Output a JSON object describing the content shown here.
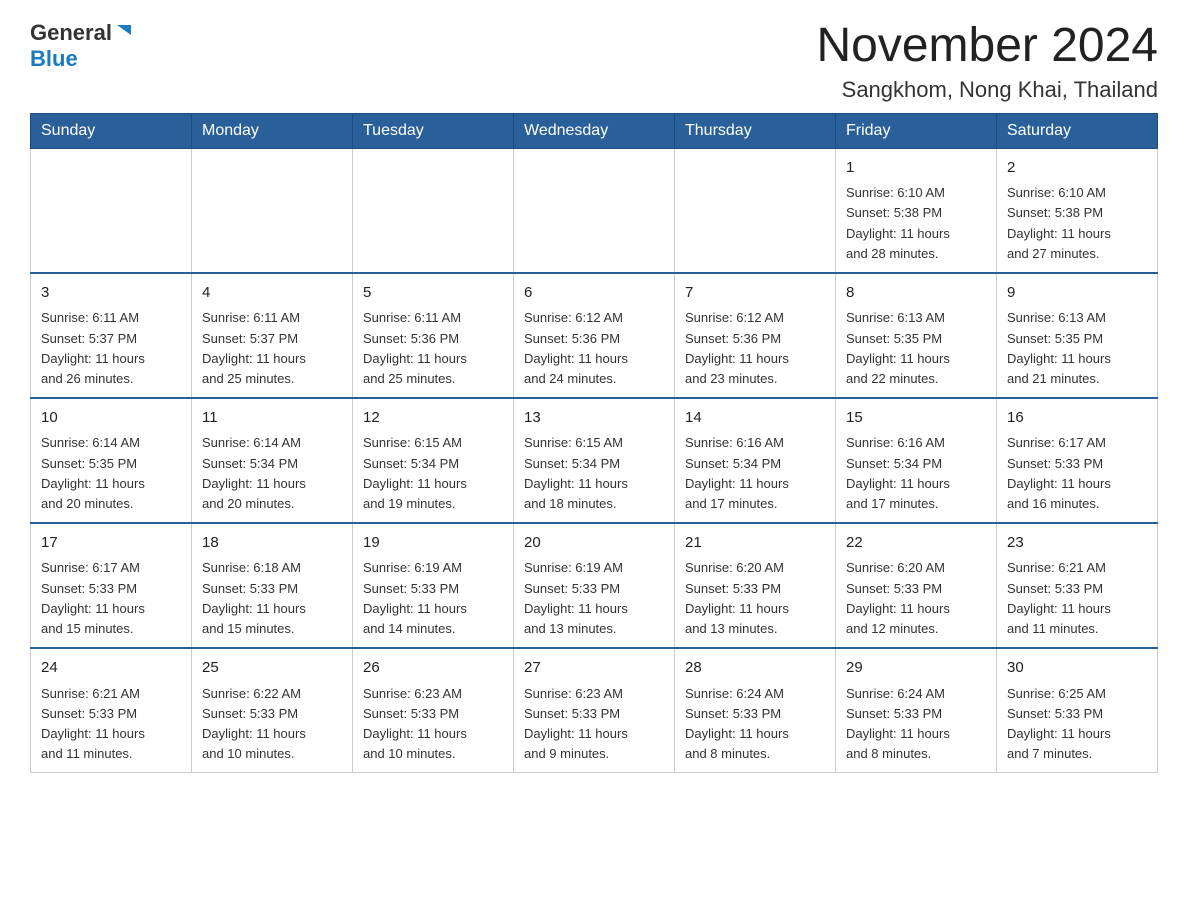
{
  "logo": {
    "general": "General",
    "triangle": "▶",
    "blue": "Blue"
  },
  "title": "November 2024",
  "subtitle": "Sangkhom, Nong Khai, Thailand",
  "weekdays": [
    "Sunday",
    "Monday",
    "Tuesday",
    "Wednesday",
    "Thursday",
    "Friday",
    "Saturday"
  ],
  "weeks": [
    [
      {
        "day": "",
        "info": ""
      },
      {
        "day": "",
        "info": ""
      },
      {
        "day": "",
        "info": ""
      },
      {
        "day": "",
        "info": ""
      },
      {
        "day": "",
        "info": ""
      },
      {
        "day": "1",
        "info": "Sunrise: 6:10 AM\nSunset: 5:38 PM\nDaylight: 11 hours\nand 28 minutes."
      },
      {
        "day": "2",
        "info": "Sunrise: 6:10 AM\nSunset: 5:38 PM\nDaylight: 11 hours\nand 27 minutes."
      }
    ],
    [
      {
        "day": "3",
        "info": "Sunrise: 6:11 AM\nSunset: 5:37 PM\nDaylight: 11 hours\nand 26 minutes."
      },
      {
        "day": "4",
        "info": "Sunrise: 6:11 AM\nSunset: 5:37 PM\nDaylight: 11 hours\nand 25 minutes."
      },
      {
        "day": "5",
        "info": "Sunrise: 6:11 AM\nSunset: 5:36 PM\nDaylight: 11 hours\nand 25 minutes."
      },
      {
        "day": "6",
        "info": "Sunrise: 6:12 AM\nSunset: 5:36 PM\nDaylight: 11 hours\nand 24 minutes."
      },
      {
        "day": "7",
        "info": "Sunrise: 6:12 AM\nSunset: 5:36 PM\nDaylight: 11 hours\nand 23 minutes."
      },
      {
        "day": "8",
        "info": "Sunrise: 6:13 AM\nSunset: 5:35 PM\nDaylight: 11 hours\nand 22 minutes."
      },
      {
        "day": "9",
        "info": "Sunrise: 6:13 AM\nSunset: 5:35 PM\nDaylight: 11 hours\nand 21 minutes."
      }
    ],
    [
      {
        "day": "10",
        "info": "Sunrise: 6:14 AM\nSunset: 5:35 PM\nDaylight: 11 hours\nand 20 minutes."
      },
      {
        "day": "11",
        "info": "Sunrise: 6:14 AM\nSunset: 5:34 PM\nDaylight: 11 hours\nand 20 minutes."
      },
      {
        "day": "12",
        "info": "Sunrise: 6:15 AM\nSunset: 5:34 PM\nDaylight: 11 hours\nand 19 minutes."
      },
      {
        "day": "13",
        "info": "Sunrise: 6:15 AM\nSunset: 5:34 PM\nDaylight: 11 hours\nand 18 minutes."
      },
      {
        "day": "14",
        "info": "Sunrise: 6:16 AM\nSunset: 5:34 PM\nDaylight: 11 hours\nand 17 minutes."
      },
      {
        "day": "15",
        "info": "Sunrise: 6:16 AM\nSunset: 5:34 PM\nDaylight: 11 hours\nand 17 minutes."
      },
      {
        "day": "16",
        "info": "Sunrise: 6:17 AM\nSunset: 5:33 PM\nDaylight: 11 hours\nand 16 minutes."
      }
    ],
    [
      {
        "day": "17",
        "info": "Sunrise: 6:17 AM\nSunset: 5:33 PM\nDaylight: 11 hours\nand 15 minutes."
      },
      {
        "day": "18",
        "info": "Sunrise: 6:18 AM\nSunset: 5:33 PM\nDaylight: 11 hours\nand 15 minutes."
      },
      {
        "day": "19",
        "info": "Sunrise: 6:19 AM\nSunset: 5:33 PM\nDaylight: 11 hours\nand 14 minutes."
      },
      {
        "day": "20",
        "info": "Sunrise: 6:19 AM\nSunset: 5:33 PM\nDaylight: 11 hours\nand 13 minutes."
      },
      {
        "day": "21",
        "info": "Sunrise: 6:20 AM\nSunset: 5:33 PM\nDaylight: 11 hours\nand 13 minutes."
      },
      {
        "day": "22",
        "info": "Sunrise: 6:20 AM\nSunset: 5:33 PM\nDaylight: 11 hours\nand 12 minutes."
      },
      {
        "day": "23",
        "info": "Sunrise: 6:21 AM\nSunset: 5:33 PM\nDaylight: 11 hours\nand 11 minutes."
      }
    ],
    [
      {
        "day": "24",
        "info": "Sunrise: 6:21 AM\nSunset: 5:33 PM\nDaylight: 11 hours\nand 11 minutes."
      },
      {
        "day": "25",
        "info": "Sunrise: 6:22 AM\nSunset: 5:33 PM\nDaylight: 11 hours\nand 10 minutes."
      },
      {
        "day": "26",
        "info": "Sunrise: 6:23 AM\nSunset: 5:33 PM\nDaylight: 11 hours\nand 10 minutes."
      },
      {
        "day": "27",
        "info": "Sunrise: 6:23 AM\nSunset: 5:33 PM\nDaylight: 11 hours\nand 9 minutes."
      },
      {
        "day": "28",
        "info": "Sunrise: 6:24 AM\nSunset: 5:33 PM\nDaylight: 11 hours\nand 8 minutes."
      },
      {
        "day": "29",
        "info": "Sunrise: 6:24 AM\nSunset: 5:33 PM\nDaylight: 11 hours\nand 8 minutes."
      },
      {
        "day": "30",
        "info": "Sunrise: 6:25 AM\nSunset: 5:33 PM\nDaylight: 11 hours\nand 7 minutes."
      }
    ]
  ]
}
